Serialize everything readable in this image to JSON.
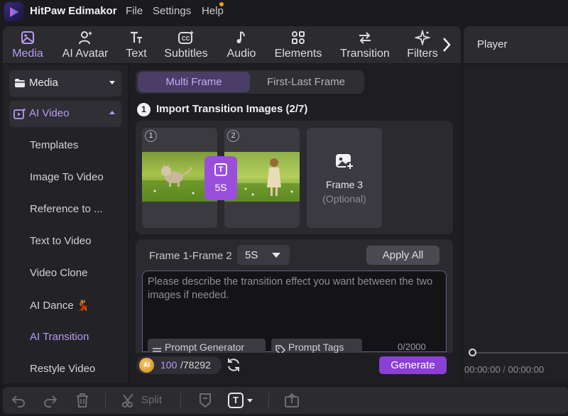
{
  "app": {
    "title": "HitPaw Edimakor",
    "menus": [
      "File",
      "Settings",
      "Help"
    ]
  },
  "toolbar": {
    "tabs": [
      {
        "label": "Media",
        "icon": "media-icon",
        "active": true
      },
      {
        "label": "AI Avatar",
        "icon": "ai-avatar-icon"
      },
      {
        "label": "Text",
        "icon": "text-icon"
      },
      {
        "label": "Subtitles",
        "icon": "subtitles-icon"
      },
      {
        "label": "Audio",
        "icon": "audio-icon"
      },
      {
        "label": "Elements",
        "icon": "elements-icon"
      },
      {
        "label": "Transition",
        "icon": "transition-icon"
      },
      {
        "label": "Filters",
        "icon": "filters-icon"
      }
    ]
  },
  "player": {
    "title": "Player",
    "current_time": "00:00:00",
    "separator": "/",
    "total_time": "00:00:00"
  },
  "sidebar": {
    "media_label": "Media",
    "ai_video_label": "AI Video",
    "items": [
      {
        "label": "Templates"
      },
      {
        "label": "Image To Video"
      },
      {
        "label": "Reference to ..."
      },
      {
        "label": "Text to Video"
      },
      {
        "label": "Video Clone"
      },
      {
        "label": "AI Dance 💃"
      },
      {
        "label": "AI Transition",
        "active": true
      },
      {
        "label": "Restyle Video"
      }
    ]
  },
  "main": {
    "mode_tabs": [
      "Multi Frame",
      "First-Last Frame"
    ],
    "active_mode": "Multi Frame",
    "step_number": "1",
    "step_title": "Import Transition Images (2/7)",
    "frames": [
      {
        "badge": "1",
        "image": "kitten running on grass"
      },
      {
        "badge": "2",
        "image": "child standing in meadow"
      }
    ],
    "transition_badge": {
      "icon_letter": "T",
      "duration": "5S"
    },
    "frame3": {
      "label": "Frame 3",
      "sub": "(Optional)"
    },
    "pair_label": "Frame 1-Frame 2",
    "duration_value": "5S",
    "apply_all": "Apply All",
    "prompt_placeholder": "Please describe the transition effect you want between the two images if needed.",
    "prompt_generator": "Prompt Generator",
    "prompt_tags": "Prompt Tags",
    "char_count": "0/2000"
  },
  "credits": {
    "coin_label": "AI",
    "used": "100",
    "total": "/78292",
    "generate": "Generate"
  },
  "bottom_toolbar": {
    "split_label": "Split",
    "text_icon_letter": "T"
  },
  "colors": {
    "accent": "#b99af5",
    "generate": "#8a3fd6",
    "transition_badge": "#9a4fdc",
    "background": "#1b1b1f"
  }
}
